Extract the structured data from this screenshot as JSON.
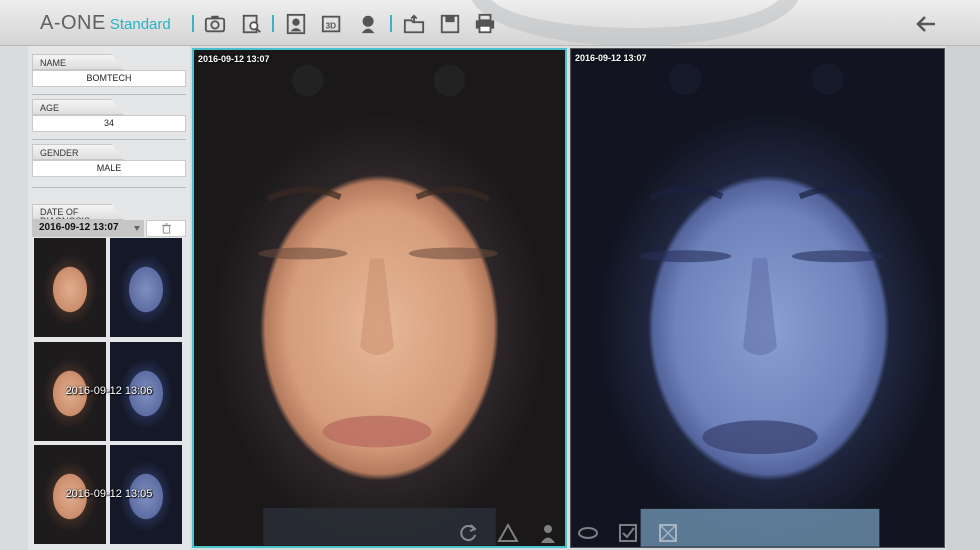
{
  "app": {
    "brand": "A-ONE",
    "edition": "Standard"
  },
  "toolbar": {
    "icons": [
      "camera-icon",
      "magnify-report-icon",
      "portrait-icon",
      "3d-icon",
      "skin-analysis-icon",
      "export-folder-icon",
      "save-icon",
      "print-icon"
    ],
    "back_icon": "back-arrow-icon"
  },
  "patient": {
    "name_label": "NAME",
    "name": "BOMTECH",
    "age_label": "AGE",
    "age": "34",
    "gender_label": "GENDER",
    "gender": "MALE",
    "diagnosis_label": "DATE OF DIAGNOSIS",
    "diagnosis_date": "2016-09-12 13:07"
  },
  "sessions": [
    {
      "stamp": ""
    },
    {
      "stamp": "2016-09-12 13:06"
    },
    {
      "stamp": "2016-09-12 13:05"
    }
  ],
  "main": {
    "left_stamp": "2016-09-12 13:07",
    "right_stamp": "2016-09-12 13:07"
  },
  "colors": {
    "accent": "#27b3c3",
    "selection_border": "#48c2cc"
  },
  "bottom_tools": [
    "rotate-icon",
    "triangle-icon",
    "person-icon",
    "lips-icon",
    "check-icon",
    "crop-icon"
  ]
}
